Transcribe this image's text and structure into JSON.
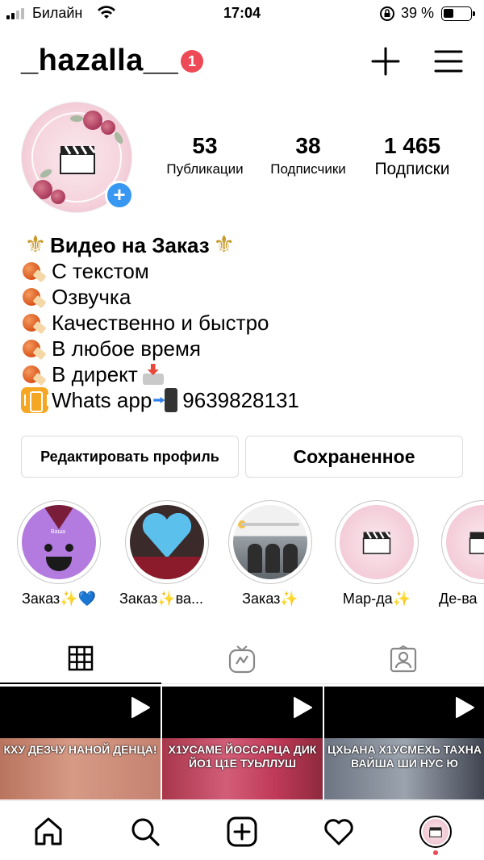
{
  "status_bar": {
    "carrier": "Билайн",
    "time": "17:04",
    "battery_percent": "39 %",
    "battery_level": 0.39
  },
  "header": {
    "username": "_hazalla__",
    "notification_count": "1",
    "icons": [
      "plus-icon",
      "menu-icon"
    ]
  },
  "profile": {
    "stats": [
      {
        "value": "53",
        "label": "Публикации"
      },
      {
        "value": "38",
        "label": "Подписчики"
      },
      {
        "value": "1 465",
        "label": "Подписки"
      }
    ]
  },
  "bio": {
    "title": "Видео на Заказ",
    "lines": [
      "С текстом",
      "Озвучка",
      "Качественно и быстро",
      "В любое время",
      "В директ",
      "Whats app",
      "9639828131"
    ]
  },
  "buttons": {
    "edit_profile": "Редактировать профиль",
    "saved": "Сохраненное"
  },
  "highlights": [
    {
      "label": "Заказ",
      "label_suffix": "💙",
      "badge_text": "Ваша"
    },
    {
      "label": "Заказ",
      "label_suffix": "ва..."
    },
    {
      "label": "Заказ",
      "label_suffix": ""
    },
    {
      "label": "Мар-да",
      "label_suffix": ""
    },
    {
      "label": "Де-ва",
      "label_suffix": ""
    }
  ],
  "tabs": [
    "grid-icon",
    "igtv-icon",
    "tagged-icon"
  ],
  "posts": [
    {
      "caption": "КХУ ДЕЗЧУ НАНОЙ ДЕНЦА!"
    },
    {
      "caption": "Х1УСАМЕ ЙОССАРЦА ДИК ЙО1 Ц1Е ТУЬЛЛУШ"
    },
    {
      "caption": "ЦХЬАНА Х1УСМЕХЬ ТАХНА ВАЙША ШИ НУС Ю"
    }
  ],
  "bottom_nav": [
    "home-icon",
    "search-icon",
    "new-post-icon",
    "heart-icon",
    "profile-avatar"
  ],
  "colors": {
    "accent_blue": "#3897f0",
    "badge_red": "#ed4956",
    "fleur_gold": "#c89a2c"
  }
}
